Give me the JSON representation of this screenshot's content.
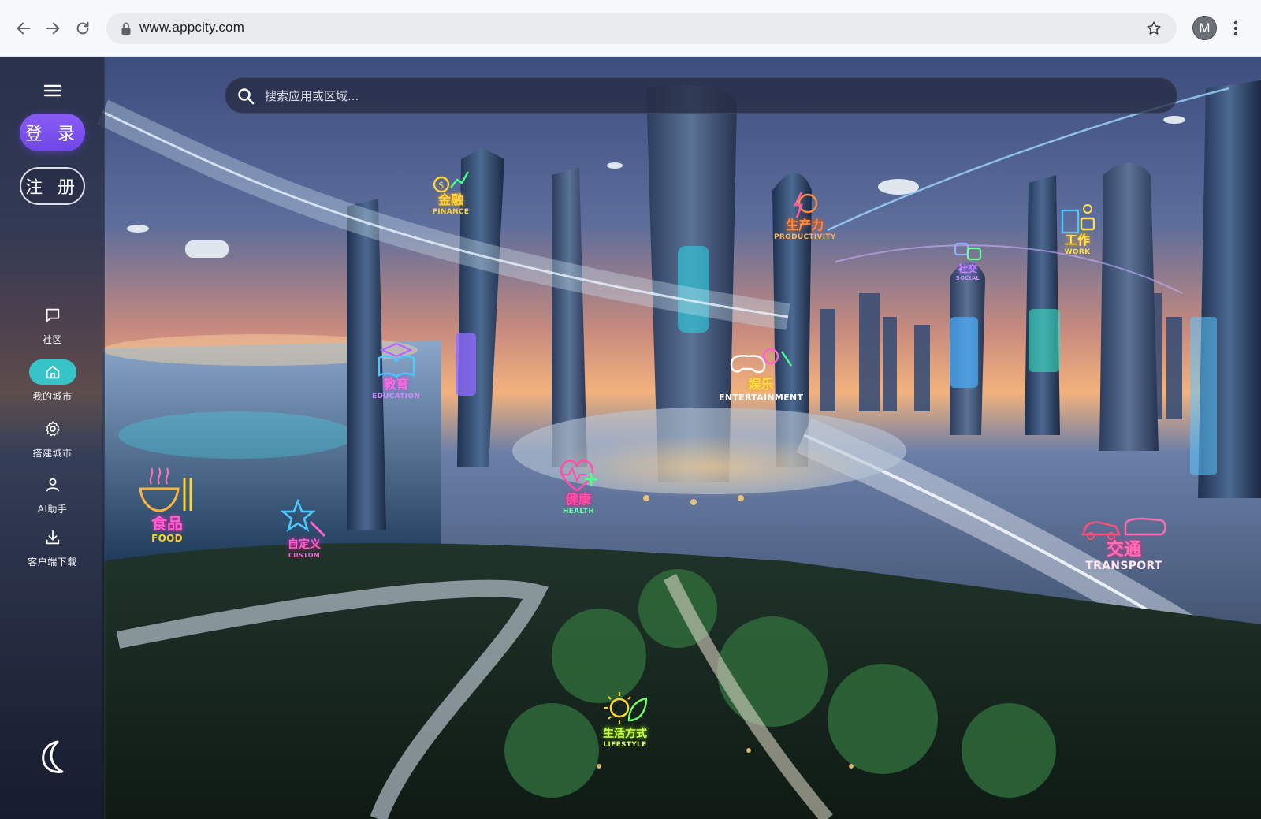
{
  "browser": {
    "url": "www.appcity.com",
    "profile_initial": "M",
    "icons": [
      "back-arrow-icon",
      "forward-arrow-icon",
      "reload-icon",
      "lock-icon",
      "star-icon",
      "kebab-menu-icon"
    ]
  },
  "sidebar": {
    "login_label": "登 录",
    "register_label": "注 册",
    "items": [
      {
        "label": "社区",
        "icon": "chat-bubble-icon",
        "active": false
      },
      {
        "label": "我的城市",
        "icon": "home-icon",
        "active": true
      },
      {
        "label": "搭建城市",
        "icon": "gear-icon",
        "active": false
      },
      {
        "label": "AI助手",
        "icon": "person-icon",
        "active": false
      },
      {
        "label": "客户端下载",
        "icon": "download-icon",
        "active": false
      }
    ],
    "theme_icon": "moon-icon"
  },
  "search": {
    "placeholder": "搜索应用或区域..."
  },
  "districts": [
    {
      "cn": "金融",
      "en": "FINANCE",
      "color": "#ffd23a"
    },
    {
      "cn": "生产力",
      "en": "PRODUCTIVITY",
      "color": "#ff8a3d"
    },
    {
      "cn": "工作",
      "en": "WORK",
      "color": "#ffe14a"
    },
    {
      "cn": "社交",
      "en": "SOCIAL",
      "color": "#c58bff"
    },
    {
      "cn": "教育",
      "en": "EDUCATION",
      "color": "#b76bff"
    },
    {
      "cn": "娱乐",
      "en": "ENTERTAINMENT",
      "color": "#ffffff"
    },
    {
      "cn": "健康",
      "en": "HEALTH",
      "color": "#ff4fa8"
    },
    {
      "cn": "食品",
      "en": "FOOD",
      "color": "#ffd42a"
    },
    {
      "cn": "自定义",
      "en": "CUSTOM",
      "color": "#ff5fcf"
    },
    {
      "cn": "交通",
      "en": "TRANSPORT",
      "color": "#ff6fb4"
    },
    {
      "cn": "生活方式",
      "en": "LIFESTYLE",
      "color": "#d9ff4a"
    }
  ],
  "colors": {
    "accent_login": "#7a50ef",
    "accent_active": "#36c4c8"
  }
}
